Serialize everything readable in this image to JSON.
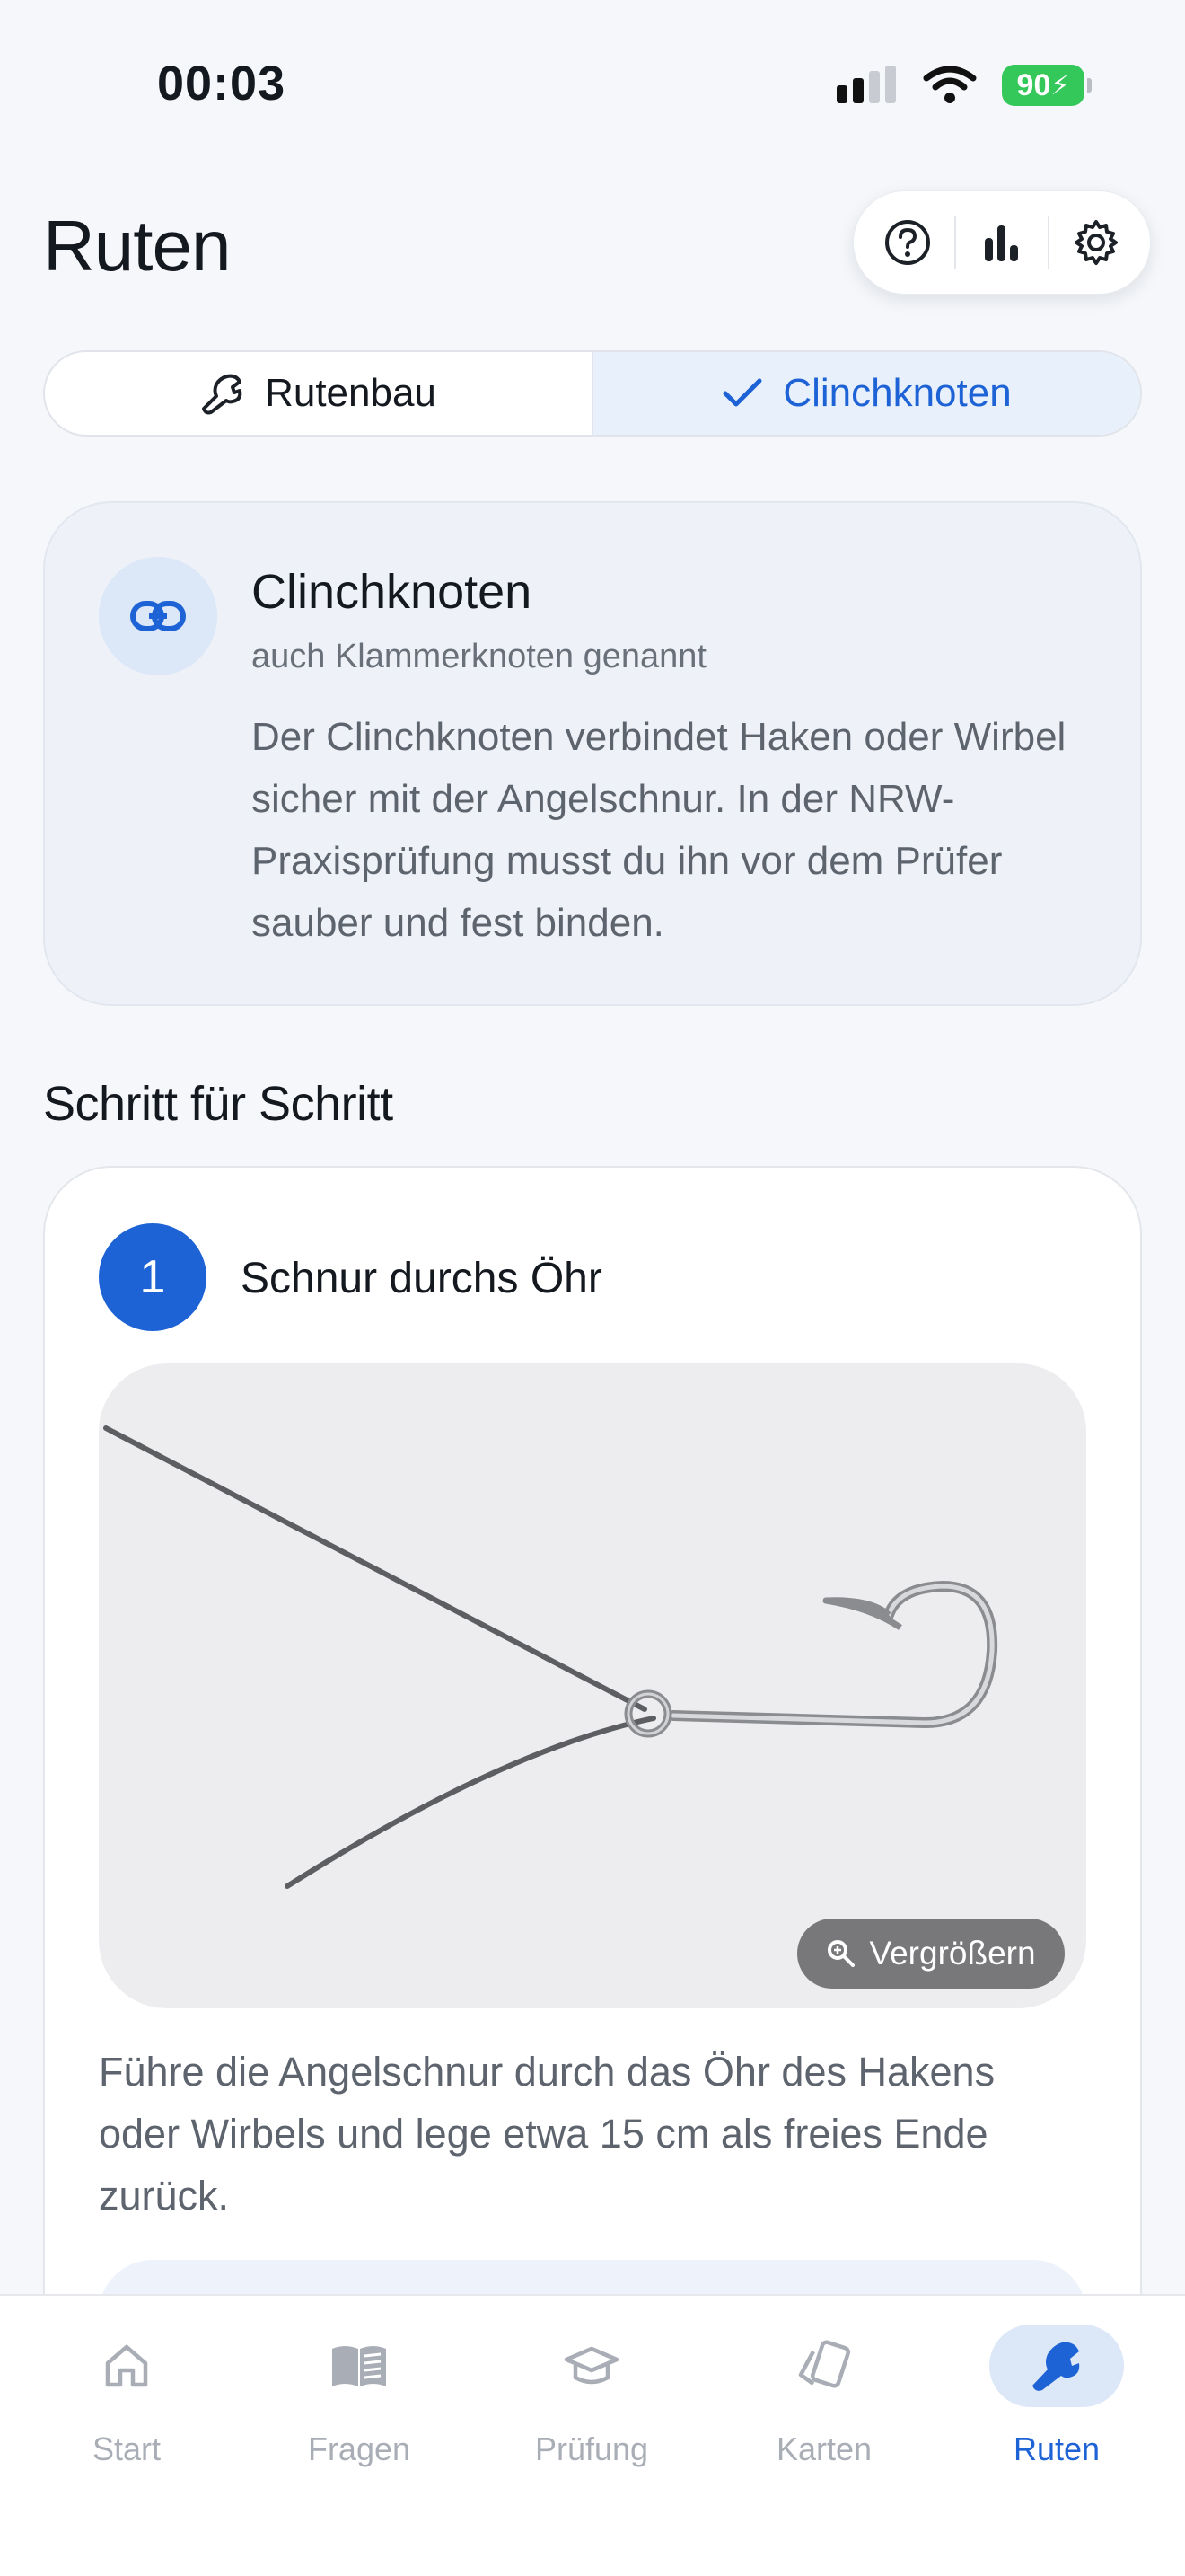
{
  "status_bar": {
    "time": "00:03",
    "battery": "90"
  },
  "header": {
    "title": "Ruten"
  },
  "segments": [
    {
      "label": "Rutenbau",
      "active": false
    },
    {
      "label": "Clinchknoten",
      "active": true
    }
  ],
  "info": {
    "title": "Clinchknoten",
    "subtitle": "auch Klammerknoten genannt",
    "body": "Der Clinchknoten verbindet Haken oder Wirbel sicher mit der Angelschnur. In der NRW-Praxisprüfung musst du ihn vor dem Prüfer sauber und fest binden."
  },
  "section": {
    "title": "Schritt für Schritt"
  },
  "step": {
    "number": "1",
    "title": "Schnur durchs Öhr",
    "zoom_label": "Vergrößern",
    "text": "Führe die Angelschnur durch das Öhr des Hakens oder Wirbels und lege etwa 15 cm als freies Ende zurück."
  },
  "tabs": [
    {
      "label": "Start",
      "icon": "home-icon"
    },
    {
      "label": "Fragen",
      "icon": "book-icon"
    },
    {
      "label": "Prüfung",
      "icon": "graduation-cap-icon"
    },
    {
      "label": "Karten",
      "icon": "cards-icon"
    },
    {
      "label": "Ruten",
      "icon": "wrench-icon",
      "active": true
    }
  ],
  "colors": {
    "accent": "#1E63D6",
    "background": "#F5F7FA",
    "battery": "#34C759"
  }
}
